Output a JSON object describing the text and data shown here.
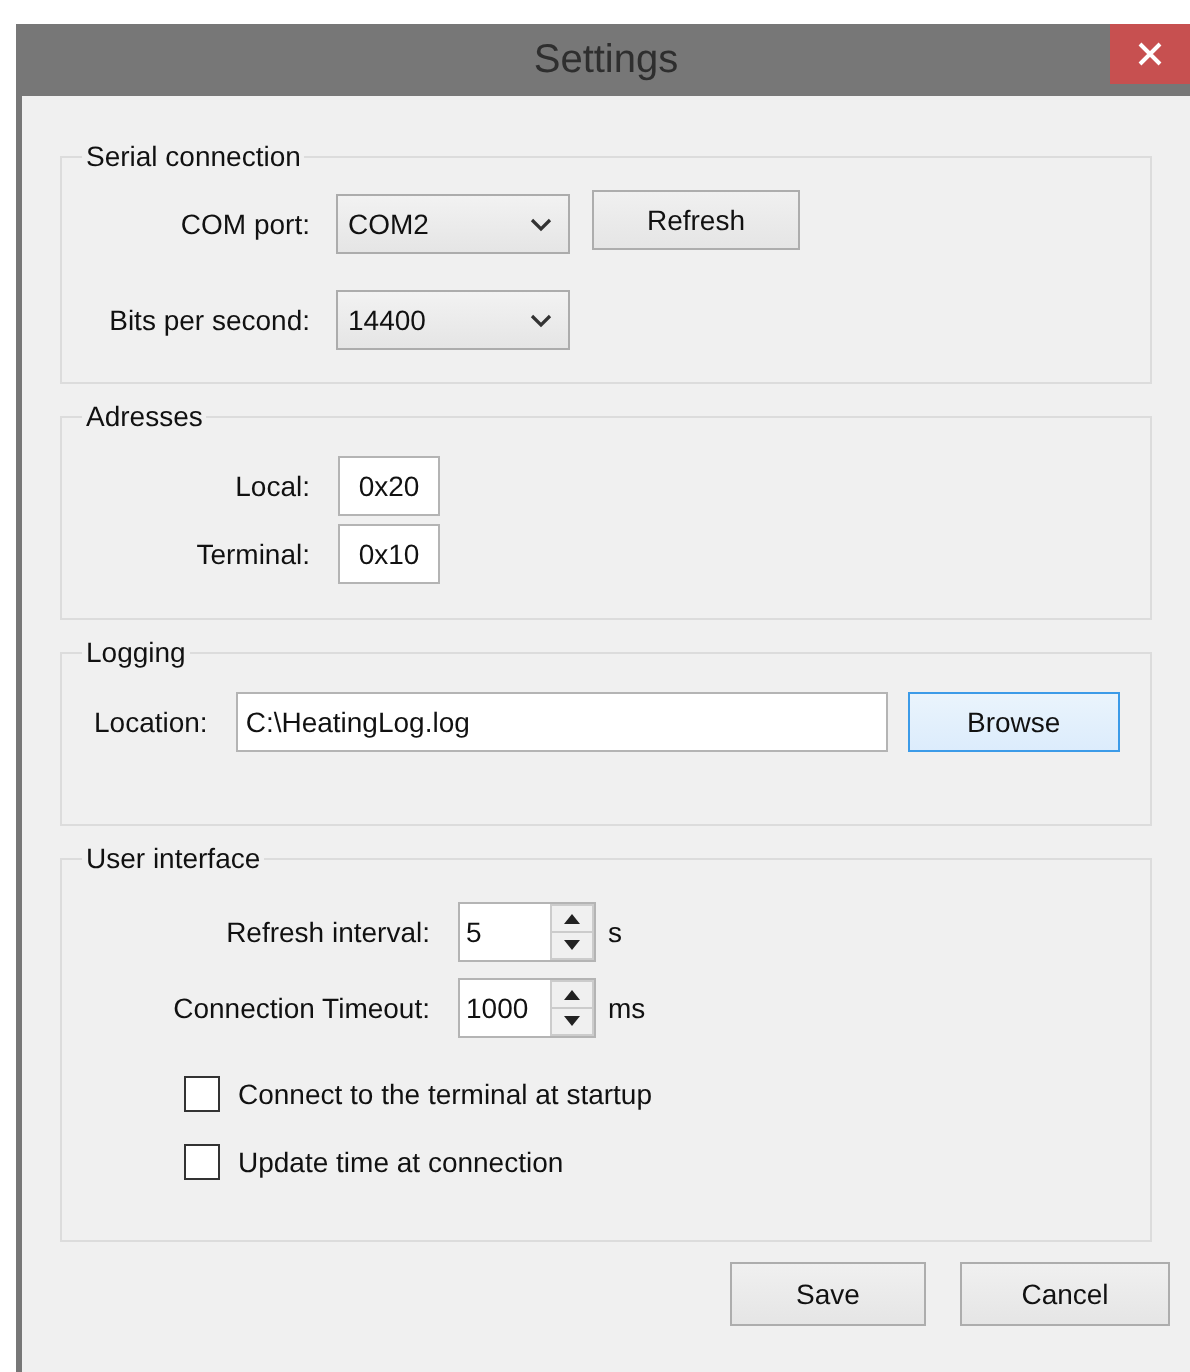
{
  "window": {
    "title": "Settings"
  },
  "serial_connection": {
    "title": "Serial connection",
    "com_port": {
      "label": "COM port:",
      "value": "COM2"
    },
    "refresh_button": "Refresh",
    "bits_per_second": {
      "label": "Bits per second:",
      "value": "14400"
    }
  },
  "adresses": {
    "title": "Adresses",
    "fields": [
      {
        "label": "Local:",
        "value": "0x20"
      },
      {
        "label": "Terminal:",
        "value": "0x10"
      }
    ]
  },
  "logging": {
    "title": "Logging",
    "location": {
      "label": "Location:",
      "value": "C:\\HeatingLog.log"
    },
    "browse_button": {
      "label": "Browse",
      "focused": true
    }
  },
  "user_interface": {
    "title": "User interface",
    "spinners": [
      {
        "label": "Refresh interval:",
        "value": "5",
        "unit": "s"
      },
      {
        "label": "Connection Timeout:",
        "value": "1000",
        "unit": "ms"
      }
    ],
    "checkboxes": [
      {
        "label": "Connect to the terminal at startup",
        "checked": false
      },
      {
        "label": "Update time at connection",
        "checked": false
      }
    ]
  },
  "buttons": [
    "Save",
    "Cancel"
  ]
}
